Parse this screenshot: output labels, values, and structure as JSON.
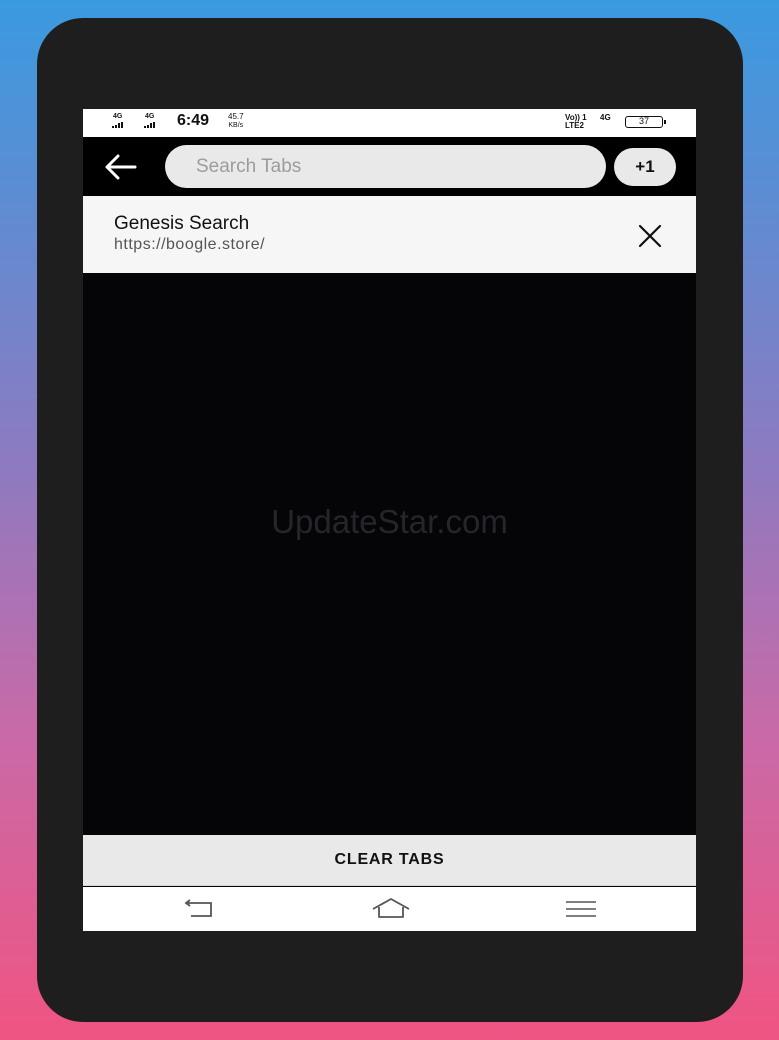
{
  "status_bar": {
    "net1": "4G",
    "net2": "4G",
    "time": "6:49",
    "speed_value": "45.7",
    "speed_unit": "KB/s",
    "volte": "Vo)) 1",
    "lte": "LTE2",
    "net3": "4G",
    "battery": "37"
  },
  "toolbar": {
    "search_placeholder": "Search Tabs",
    "tab_count": "+1"
  },
  "tabs": [
    {
      "title": "Genesis Search",
      "url": "https://boogle.store/"
    }
  ],
  "watermark": "UpdateStar.com",
  "clear_tabs_label": "CLEAR TABS",
  "icons": {
    "back": "arrow-left-icon",
    "close": "close-icon",
    "nav_back": "nav-back-icon",
    "nav_home": "nav-home-icon",
    "nav_menu": "nav-menu-icon"
  },
  "colors": {
    "toolbar_bg": "#000000",
    "search_bg": "#e9e9e9",
    "tab_bg": "#f6f6f6",
    "content_bg": "#050508"
  }
}
